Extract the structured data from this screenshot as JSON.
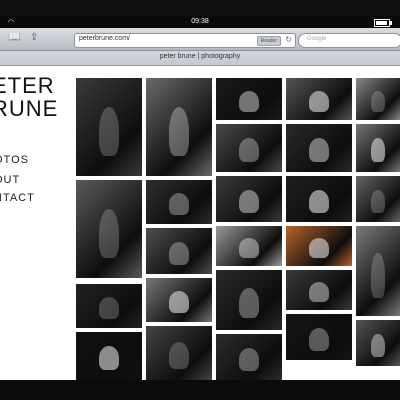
{
  "status_bar": {
    "time": "09:38",
    "battery_level": 0.9
  },
  "browser": {
    "url": "peterbrune.com/",
    "reader_label": "Reader",
    "search_placeholder": "Google",
    "page_title": "peter brune | photography"
  },
  "site": {
    "logo_line1": "ETER",
    "logo_line2": "RUNE",
    "nav": [
      {
        "label": "OTOS"
      },
      {
        "label": "OUT"
      },
      {
        "label": "NTACT"
      }
    ]
  },
  "colors": {
    "toolbar": "#c4c8cf",
    "text": "#222222",
    "accent": "#d2691e"
  },
  "icons": [
    "wifi-icon",
    "battery-icon",
    "bookmarks-icon",
    "share-icon",
    "reload-icon"
  ]
}
